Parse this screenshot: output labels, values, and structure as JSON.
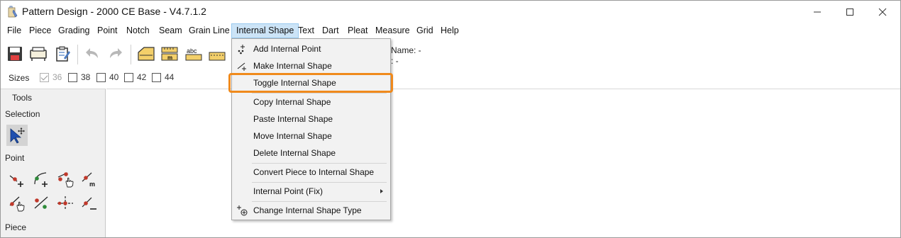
{
  "window": {
    "title": "Pattern Design - 2000 CE Base - V4.7.1.2",
    "controls": {
      "minimize_icon": "minimize-icon",
      "maximize_icon": "maximize-icon",
      "close_icon": "close-icon"
    }
  },
  "menubar": {
    "items": [
      "File",
      "Piece",
      "Grading",
      "Point",
      "Notch",
      "Seam",
      "Grain Line",
      "Internal Shape",
      "Text",
      "Dart",
      "Pleat",
      "Measure",
      "Grid",
      "Help"
    ],
    "active": "Internal Shape"
  },
  "toolbar": {
    "icons": [
      "save-icon",
      "plotter-icon",
      "clipboard-notes-icon",
      "undo-icon",
      "redo-icon",
      "folder-piece-icon",
      "measure-ruler-icon",
      "text-abc-icon",
      "seam-dash-icon"
    ],
    "partial_text_1": "Name: -",
    "partial_text_2": ": -"
  },
  "sizes": {
    "label": "Sizes",
    "options": [
      {
        "value": "36",
        "checked": true,
        "disabled": true
      },
      {
        "value": "38",
        "checked": false,
        "disabled": false
      },
      {
        "value": "40",
        "checked": false,
        "disabled": false
      },
      {
        "value": "42",
        "checked": false,
        "disabled": false
      },
      {
        "value": "44",
        "checked": false,
        "disabled": false
      }
    ]
  },
  "tools_panel": {
    "title": "Tools",
    "selection_label": "Selection",
    "point_label": "Point",
    "piece_label": "Piece"
  },
  "dropdown": {
    "items": {
      "add_internal_point": "Add Internal Point",
      "make_internal_shape": "Make Internal Shape",
      "toggle_internal_shape": "Toggle Internal Shape",
      "copy_internal_shape": "Copy Internal Shape",
      "paste_internal_shape": "Paste Internal Shape",
      "move_internal_shape": "Move Internal Shape",
      "delete_internal_shape": "Delete Internal Shape",
      "convert_piece": "Convert Piece to Internal Shape",
      "internal_point_fix": "Internal Point (Fix)",
      "change_type": "Change Internal Shape Type"
    },
    "highlighted": "Toggle Internal Shape",
    "highlight_color": "#f08a1c"
  },
  "colors": {
    "menu_active_bg": "#cce4f7",
    "point_red": "#c0392b",
    "point_green": "#2e8b3a"
  }
}
